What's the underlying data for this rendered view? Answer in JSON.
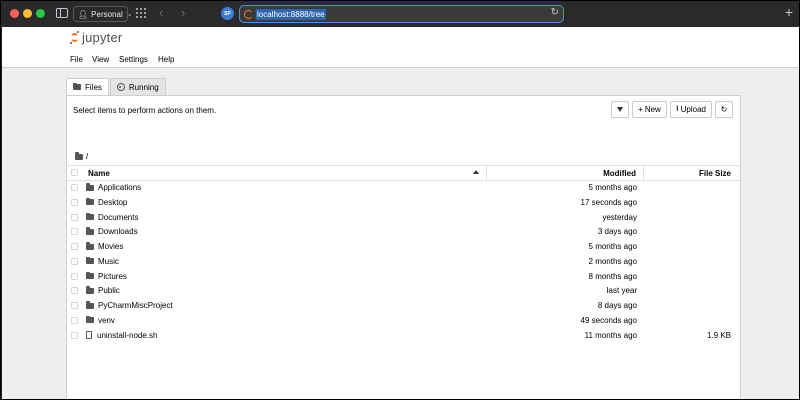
{
  "browser": {
    "profile_label": "Personal",
    "url": "localhost:8888/tree",
    "extension_label": "SP"
  },
  "app": {
    "logo_text": "jupyter"
  },
  "menu": [
    "File",
    "View",
    "Settings",
    "Help"
  ],
  "tabs": [
    {
      "label": "Files",
      "active": true
    },
    {
      "label": "Running",
      "active": false
    }
  ],
  "toolbar": {
    "instruction": "Select items to perform actions on them.",
    "new_label": "New",
    "upload_label": "Upload"
  },
  "breadcrumb": "/",
  "table": {
    "headers": {
      "name": "Name",
      "modified": "Modified",
      "size": "File Size"
    },
    "rows": [
      {
        "name": "Applications",
        "type": "folder",
        "modified": "5 months ago",
        "size": ""
      },
      {
        "name": "Desktop",
        "type": "folder",
        "modified": "17 seconds ago",
        "size": ""
      },
      {
        "name": "Documents",
        "type": "folder",
        "modified": "yesterday",
        "size": ""
      },
      {
        "name": "Downloads",
        "type": "folder",
        "modified": "3 days ago",
        "size": ""
      },
      {
        "name": "Movies",
        "type": "folder",
        "modified": "5 months ago",
        "size": ""
      },
      {
        "name": "Music",
        "type": "folder",
        "modified": "2 months ago",
        "size": ""
      },
      {
        "name": "Pictures",
        "type": "folder",
        "modified": "8 months ago",
        "size": ""
      },
      {
        "name": "Public",
        "type": "folder",
        "modified": "last year",
        "size": ""
      },
      {
        "name": "PyCharmMiscProject",
        "type": "folder",
        "modified": "8 days ago",
        "size": ""
      },
      {
        "name": "venv",
        "type": "folder",
        "modified": "49 seconds ago",
        "size": ""
      },
      {
        "name": "uninstall-node.sh",
        "type": "file",
        "modified": "11 months ago",
        "size": "1.9 KB"
      }
    ]
  },
  "colors": {
    "jupyter_orange": "#f37726",
    "url_highlight": "#2d64b5",
    "focus_ring": "#4a90e2"
  }
}
